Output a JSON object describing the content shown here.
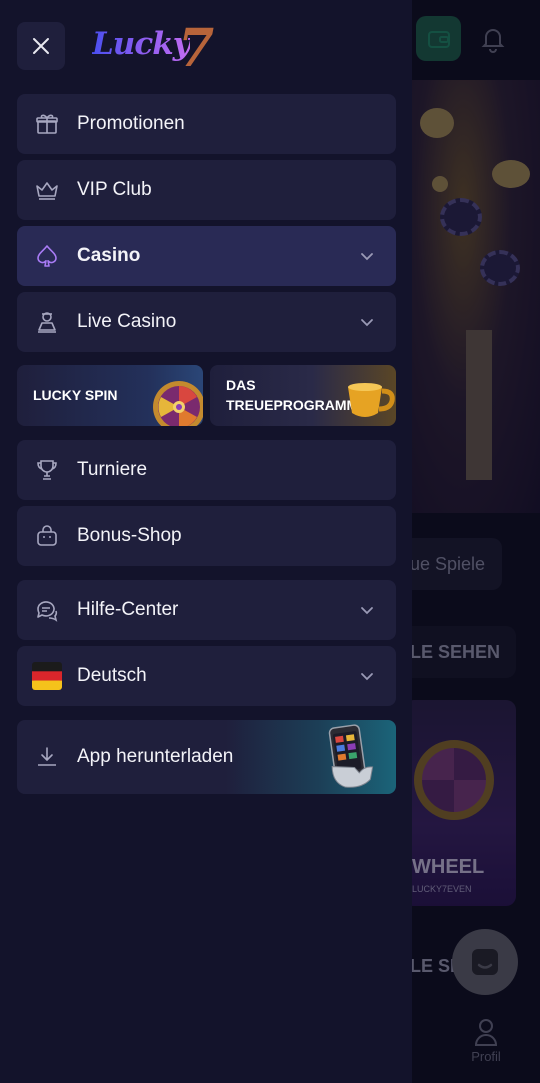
{
  "background": {
    "chip_label": "ue Spiele",
    "see_all_label": "LE SEHEN",
    "see_all_label_2": "LE SE",
    "wheel_card_title": "WHEEL",
    "wheel_card_sub": "LUCKY7EVEN",
    "nav_profile_label": "Profil"
  },
  "drawer": {
    "close_icon": "close-icon",
    "logo_text": "Lucky",
    "logo_seven": "7",
    "menu": [
      {
        "label": "Promotionen",
        "icon": "gift-icon",
        "has_chevron": false
      },
      {
        "label": "VIP Club",
        "icon": "crown-icon",
        "has_chevron": false
      },
      {
        "label": "Casino",
        "icon": "spade-icon",
        "has_chevron": true,
        "active": true
      },
      {
        "label": "Live Casino",
        "icon": "dealer-icon",
        "has_chevron": true
      },
      {
        "label": "Turniere",
        "icon": "trophy-icon",
        "has_chevron": false
      },
      {
        "label": "Bonus-Shop",
        "icon": "shopping-bag-icon",
        "has_chevron": false
      },
      {
        "label": "Hilfe-Center",
        "icon": "chat-bubbles-icon",
        "has_chevron": true
      },
      {
        "label": "Deutsch",
        "icon": "german-flag-icon",
        "has_chevron": true
      }
    ],
    "promos": [
      {
        "label": "LUCKY SPIN"
      },
      {
        "label_line1": "DAS",
        "label_line2": "TREUEPROGRAMM"
      }
    ],
    "app_download_label": "App herunterladen"
  },
  "colors": {
    "drawer_bg": "#13132b",
    "item_bg": "#1f1f3c",
    "active_bg": "#292a55",
    "accent_purple": "#a87bf5"
  }
}
